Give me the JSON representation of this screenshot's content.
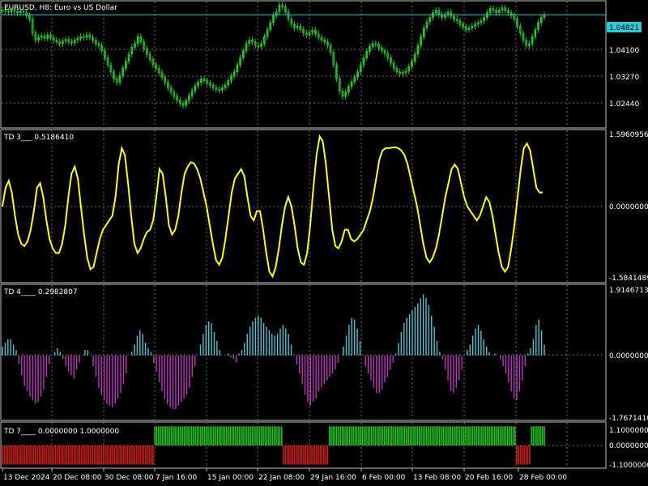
{
  "window": {
    "symbol_title": "EURUSD, H8:  Euro vs US Dollar"
  },
  "colors": {
    "background": "#000000",
    "grid": "#6b6b6b",
    "frame": "#c0c0c0",
    "candle": "#22c322",
    "bid_line": "#2fc9d9",
    "td3_line": "#ffff00",
    "td4_positive": "#4fc3d6",
    "td4_negative": "#c233c2",
    "td7_positive": "#22c322",
    "td7_negative": "#c41e1e"
  },
  "price_panel": {
    "current_price": "1.04821",
    "axis_labels": [
      "1.04821",
      "1.04100",
      "1.03270",
      "1.02440"
    ],
    "price_range": [
      1.0165,
      1.0515
    ],
    "close_series": [
      1.0495,
      1.0492,
      1.049,
      1.0495,
      1.0492,
      1.0488,
      1.0493,
      1.049,
      1.048,
      1.047,
      1.043,
      1.041,
      1.0418,
      1.0422,
      1.0415,
      1.0425,
      1.0418,
      1.041,
      1.0405,
      1.04,
      1.0408,
      1.0412,
      1.0405,
      1.0402,
      1.041,
      1.0415,
      1.042,
      1.0418,
      1.0425,
      1.0418,
      1.041,
      1.04,
      1.0395,
      1.038,
      1.036,
      1.034,
      1.032,
      1.03,
      1.029,
      1.031,
      1.033,
      1.035,
      1.037,
      1.039,
      1.04,
      1.042,
      1.0405,
      1.0385,
      1.037,
      1.0355,
      1.034,
      1.033,
      1.0318,
      1.0305,
      1.029,
      1.0275,
      1.0262,
      1.025,
      1.024,
      1.023,
      1.0225,
      1.0238,
      1.0252,
      1.0266,
      1.028,
      1.029,
      1.03,
      1.0295,
      1.0288,
      1.0282,
      1.0275,
      1.027,
      1.0268,
      1.0275,
      1.0283,
      1.0295,
      1.0308,
      1.032,
      1.034,
      1.036,
      1.038,
      1.04,
      1.041,
      1.0405,
      1.0395,
      1.0392,
      1.04,
      1.042,
      1.044,
      1.046,
      1.048,
      1.049,
      1.051,
      1.0505,
      1.049,
      1.047,
      1.0455,
      1.0445,
      1.045,
      1.044,
      1.043,
      1.0425,
      1.0432,
      1.0438,
      1.0428,
      1.0418,
      1.041,
      1.0405,
      1.0395,
      1.0375,
      1.034,
      1.03,
      1.0265,
      1.025,
      1.0262,
      1.0278,
      1.0292,
      1.0305,
      1.032,
      1.034,
      1.036,
      1.0378,
      1.0392,
      1.04,
      1.0398,
      1.0388,
      1.038,
      1.0372,
      1.036,
      1.0345,
      1.033,
      1.032,
      1.0315,
      1.0318,
      1.0322,
      1.0335,
      1.035,
      1.037,
      1.0395,
      1.042,
      1.0445,
      1.0462,
      1.0475,
      1.0488,
      1.0495,
      1.0482,
      1.0475,
      1.0482,
      1.049,
      1.0478,
      1.047,
      1.0465,
      1.0455,
      1.0448,
      1.044,
      1.0445,
      1.045,
      1.0455,
      1.046,
      1.0465,
      1.0475,
      1.0488,
      1.05,
      1.0495,
      1.0488,
      1.0495,
      1.0502,
      1.0495,
      1.0488,
      1.048,
      1.047,
      1.045,
      1.043,
      1.041,
      1.0395,
      1.04,
      1.042,
      1.044,
      1.046,
      1.0475,
      1.0482
    ]
  },
  "td3_panel": {
    "label": "TD 3___  0.5186410",
    "axis_labels": [
      "1.5960956",
      "0.0000000",
      "-1.5841489"
    ],
    "range": [
      -1.5841489,
      1.5960956
    ],
    "series": [
      0.0,
      0.4,
      0.55,
      0.3,
      -0.2,
      -0.6,
      -0.8,
      -0.85,
      -0.75,
      -0.5,
      -0.1,
      0.4,
      0.5,
      0.2,
      -0.3,
      -0.7,
      -0.9,
      -1.0,
      -1.0,
      -0.8,
      -0.4,
      0.2,
      0.7,
      0.85,
      0.6,
      0.0,
      -0.6,
      -1.1,
      -1.35,
      -1.3,
      -1.0,
      -0.7,
      -0.5,
      -0.4,
      -0.3,
      -0.2,
      0.2,
      0.9,
      1.25,
      1.1,
      0.5,
      -0.2,
      -0.8,
      -1.0,
      -0.9,
      -0.7,
      -0.55,
      -0.5,
      -0.3,
      0.2,
      0.8,
      0.7,
      0.2,
      -0.4,
      -0.6,
      -0.5,
      -0.2,
      0.3,
      0.7,
      0.85,
      0.95,
      0.92,
      0.8,
      0.6,
      0.3,
      0.0,
      -0.4,
      -0.8,
      -1.15,
      -1.25,
      -1.1,
      -0.7,
      -0.2,
      0.3,
      0.6,
      0.7,
      0.8,
      0.65,
      0.2,
      -0.2,
      -0.3,
      -0.1,
      -0.1,
      -0.5,
      -1.0,
      -1.4,
      -1.5,
      -1.3,
      -0.9,
      -0.4,
      0.0,
      0.2,
      0.0,
      -0.4,
      -0.9,
      -1.2,
      -1.25,
      -1.0,
      -0.4,
      0.4,
      1.1,
      1.5,
      1.4,
      0.9,
      0.2,
      -0.5,
      -0.85,
      -0.9,
      -0.75,
      -0.5,
      -0.5,
      -0.7,
      -0.75,
      -0.7,
      -0.6,
      -0.5,
      -0.3,
      -0.1,
      0.2,
      0.6,
      1.0,
      1.2,
      1.25,
      1.25,
      1.26,
      1.27,
      1.25,
      1.2,
      1.1,
      0.9,
      0.6,
      0.3,
      0.0,
      -0.4,
      -0.8,
      -1.1,
      -1.2,
      -1.1,
      -0.9,
      -0.6,
      -0.2,
      0.2,
      0.5,
      0.8,
      0.9,
      0.8,
      0.5,
      0.2,
      0.0,
      -0.1,
      -0.2,
      -0.3,
      -0.2,
      0.0,
      0.2,
      0.1,
      -0.2,
      -0.6,
      -1.0,
      -1.3,
      -1.4,
      -1.3,
      -0.9,
      -0.4,
      0.2,
      0.8,
      1.25,
      1.35,
      1.2,
      0.8,
      0.4,
      0.3,
      0.3
    ]
  },
  "td4_panel": {
    "label": "TD 4____  0.2982807",
    "axis_labels": [
      "1.9146713",
      "0.0000000",
      "-1.7671410"
    ],
    "range": [
      -1.767141,
      1.9146713
    ],
    "values": [
      0.25,
      0.35,
      0.45,
      0.45,
      0.3,
      0.15,
      -0.25,
      -0.55,
      -0.85,
      -1.0,
      -1.15,
      -1.25,
      -1.35,
      -1.3,
      -1.15,
      -0.95,
      -0.6,
      -0.25,
      0.0,
      0.1,
      0.2,
      0.1,
      -0.1,
      -0.3,
      -0.45,
      -0.55,
      -0.65,
      -0.4,
      -0.2,
      0.0,
      0.15,
      0.15,
      0.0,
      -0.3,
      -0.6,
      -0.9,
      -1.1,
      -1.25,
      -1.35,
      -1.4,
      -1.45,
      -1.35,
      -1.2,
      -1.05,
      -0.8,
      -0.5,
      0.0,
      0.1,
      0.3,
      0.55,
      0.7,
      0.6,
      0.35,
      0.2,
      0.1,
      -0.2,
      -0.45,
      -0.75,
      -1.0,
      -1.2,
      -1.35,
      -1.45,
      -1.5,
      -1.5,
      -1.4,
      -1.3,
      -1.2,
      -1.1,
      -0.9,
      -0.6,
      -0.3,
      0.0,
      0.3,
      0.6,
      0.85,
      0.95,
      0.9,
      0.65,
      0.4,
      0.15,
      0.0,
      0.0,
      0.05,
      -0.05,
      -0.1,
      -0.2,
      0.05,
      0.15,
      0.35,
      0.6,
      0.8,
      0.95,
      1.05,
      1.1,
      1.05,
      0.9,
      0.8,
      0.7,
      0.6,
      0.55,
      0.6,
      0.75,
      0.85,
      0.75,
      0.6,
      0.3,
      0.0,
      -0.25,
      -0.5,
      -0.8,
      -1.1,
      -1.3,
      -1.4,
      -1.3,
      -1.2,
      -1.0,
      -0.9,
      -0.8,
      -0.7,
      -0.6,
      -0.5,
      -0.4,
      -0.2,
      0.0,
      0.25,
      0.55,
      0.85,
      1.05,
      1.0,
      0.75,
      0.4,
      0.0,
      -0.3,
      -0.5,
      -0.7,
      -0.9,
      -1.05,
      -1.05,
      -0.95,
      -0.75,
      -0.6,
      -0.4,
      -0.2,
      0.05,
      0.35,
      0.65,
      0.9,
      1.05,
      1.15,
      1.25,
      1.35,
      1.45,
      1.6,
      1.7,
      1.6,
      1.4,
      1.1,
      0.8,
      0.4,
      0.1,
      -0.1,
      -0.4,
      -0.7,
      -1.0,
      -1.05,
      -0.9,
      -0.7,
      -0.4,
      0.0,
      0.15,
      0.3,
      0.55,
      0.75,
      0.85,
      0.7,
      0.45,
      0.25,
      0.1,
      0.0,
      0.05,
      0.0,
      -0.1,
      -0.3,
      -0.5,
      -0.75,
      -1.0,
      -1.2,
      -1.25,
      -1.0,
      -0.7,
      -0.3,
      0.05,
      0.2,
      0.45,
      0.85,
      1.0,
      0.7,
      0.3
    ]
  },
  "td7_panel": {
    "label": "TD 7____  0.0000000  1.0000000",
    "axis_labels": [
      "1.1000000",
      "0.0000000",
      "-1.1000000"
    ],
    "range": [
      -1.1,
      1.1
    ],
    "values": [
      -1,
      -1,
      -1,
      -1,
      -1,
      -1,
      -1,
      -1,
      -1,
      -1,
      -1,
      -1,
      -1,
      -1,
      -1,
      -1,
      -1,
      -1,
      -1,
      -1,
      -1,
      -1,
      -1,
      -1,
      -1,
      -1,
      -1,
      -1,
      -1,
      -1,
      -1,
      -1,
      -1,
      -1,
      -1,
      -1,
      -1,
      -1,
      -1,
      -1,
      -1,
      -1,
      -1,
      -1,
      -1,
      -1,
      -1,
      -1,
      -1,
      -1,
      -1,
      -1,
      -1,
      -1,
      -1,
      -1,
      -1,
      -1,
      -1,
      -1,
      -1,
      -1,
      -1,
      -1,
      -1,
      -1,
      -1,
      -1,
      -1,
      -1,
      -1,
      -1,
      -1,
      -1,
      -1,
      -1,
      -1,
      -1,
      -1,
      -1,
      -1,
      -1,
      -1,
      1,
      1,
      1,
      1,
      1,
      1,
      1,
      1,
      1,
      1,
      1,
      1,
      1,
      1,
      1,
      1,
      1,
      1,
      1,
      1,
      1,
      1,
      1,
      1,
      1,
      1,
      1,
      1,
      1,
      1,
      1,
      1,
      1,
      1,
      1,
      1,
      1,
      1,
      1,
      1,
      1,
      1,
      1,
      1,
      1,
      1,
      1,
      1,
      1,
      1,
      1,
      1,
      1,
      1,
      1,
      1,
      1,
      1,
      1,
      1,
      1,
      1,
      1,
      1,
      1,
      1,
      1,
      1,
      1,
      1,
      -1,
      -1,
      -1,
      -1,
      -1,
      -1,
      -1,
      -1,
      -1,
      -1,
      -1,
      -1,
      -1,
      -1,
      -1,
      -1,
      -1,
      -1,
      -1,
      -1,
      -1,
      -1,
      -1,
      -1,
      -1,
      1,
      1,
      1,
      1,
      1,
      1,
      1,
      1,
      1,
      1,
      1,
      1,
      1,
      1,
      1,
      1,
      1,
      1,
      1,
      1,
      1,
      1,
      1,
      1,
      1,
      1,
      1,
      1,
      1,
      1,
      1,
      1,
      1,
      1,
      1,
      1,
      1,
      1,
      1,
      1,
      1,
      1,
      1,
      1,
      1,
      1,
      1,
      1,
      1,
      1,
      1,
      1,
      1,
      1,
      1,
      1,
      1,
      1,
      1,
      1,
      1,
      1,
      1,
      1,
      1,
      1,
      1,
      1,
      1,
      1,
      1,
      1,
      1,
      1,
      1,
      1,
      1,
      1,
      1,
      1,
      1,
      1,
      1,
      1,
      1,
      1,
      1,
      1,
      1,
      1,
      1,
      1,
      1,
      1,
      1,
      1,
      1,
      1,
      1,
      1,
      1,
      1,
      -1,
      -1,
      -1,
      -1,
      -1,
      -1,
      -1,
      -1,
      1,
      1,
      1,
      1,
      1,
      1,
      1,
      1
    ]
  },
  "time_axis": {
    "labels": [
      "13 Dec 2024",
      "20 Dec 08:00",
      "30 Dec 08:00",
      "7 Jan 16:00",
      "15 Jan 00:00",
      "22 Jan 08:00",
      "29 Jan 16:00",
      "6 Feb 00:00",
      "13 Feb 08:00",
      "20 Feb 16:00",
      "28 Feb 00:00"
    ]
  }
}
